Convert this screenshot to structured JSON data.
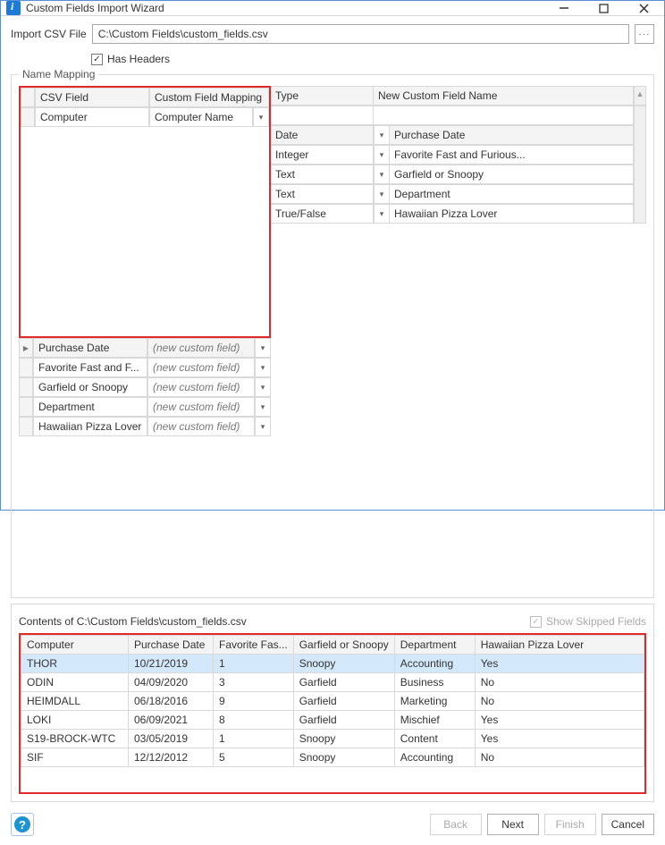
{
  "window": {
    "title": "Custom Fields Import Wizard"
  },
  "import": {
    "label": "Import CSV File",
    "path": "C:\\Custom Fields\\custom_fields.csv",
    "browse_glyph": "···",
    "has_headers_label": "Has Headers",
    "has_headers_checked": true
  },
  "mapping": {
    "group_label": "Name Mapping",
    "headers": {
      "csv": "CSV Field",
      "map": "Custom Field Mapping",
      "type": "Type",
      "new": "New Custom Field Name"
    },
    "rows": [
      {
        "csv": "Computer",
        "map": "Computer Name",
        "map_italic": false,
        "show_dd_map": true,
        "type": "",
        "show_dd_type": false,
        "new": "",
        "active": false
      },
      {
        "csv": "Purchase Date",
        "map": "(new custom field)",
        "map_italic": true,
        "show_dd_map": true,
        "type": "Date",
        "show_dd_type": true,
        "new": "Purchase Date",
        "active": true
      },
      {
        "csv": "Favorite Fast and F...",
        "map": "(new custom field)",
        "map_italic": true,
        "show_dd_map": true,
        "type": "Integer",
        "show_dd_type": true,
        "new": "Favorite Fast and Furious...",
        "active": false
      },
      {
        "csv": "Garfield or Snoopy",
        "map": "(new custom field)",
        "map_italic": true,
        "show_dd_map": true,
        "type": "Text",
        "show_dd_type": true,
        "new": "Garfield or Snoopy",
        "active": false
      },
      {
        "csv": "Department",
        "map": "(new custom field)",
        "map_italic": true,
        "show_dd_map": true,
        "type": "Text",
        "show_dd_type": true,
        "new": "Department",
        "active": false
      },
      {
        "csv": "Hawaiian Pizza Lover",
        "map": "(new custom field)",
        "map_italic": true,
        "show_dd_map": true,
        "type": "True/False",
        "show_dd_type": true,
        "new": "Hawaiian Pizza Lover",
        "active": false
      }
    ]
  },
  "preview": {
    "contents_label": "Contents of C:\\Custom Fields\\custom_fields.csv",
    "show_skipped_label": "Show Skipped Fields",
    "headers": [
      "Computer",
      "Purchase Date",
      "Favorite Fas...",
      "Garfield or Snoopy",
      "Department",
      "Hawaiian Pizza Lover"
    ],
    "rows": [
      {
        "selected": true,
        "cells": [
          "THOR",
          "10/21/2019",
          "1",
          "Snoopy",
          "Accounting",
          "Yes"
        ]
      },
      {
        "selected": false,
        "cells": [
          "ODIN",
          "04/09/2020",
          "3",
          "Garfield",
          "Business",
          "No"
        ]
      },
      {
        "selected": false,
        "cells": [
          "HEIMDALL",
          "06/18/2016",
          "9",
          "Garfield",
          "Marketing",
          "No"
        ]
      },
      {
        "selected": false,
        "cells": [
          "LOKI",
          "06/09/2021",
          "8",
          "Garfield",
          "Mischief",
          "Yes"
        ]
      },
      {
        "selected": false,
        "cells": [
          "S19-BROCK-WTC",
          "03/05/2019",
          "1",
          "Snoopy",
          "Content",
          "Yes"
        ]
      },
      {
        "selected": false,
        "cells": [
          "SIF",
          "12/12/2012",
          "5",
          "Snoopy",
          "Accounting",
          "No"
        ]
      }
    ]
  },
  "footer": {
    "back": "Back",
    "next": "Next",
    "finish": "Finish",
    "cancel": "Cancel"
  }
}
